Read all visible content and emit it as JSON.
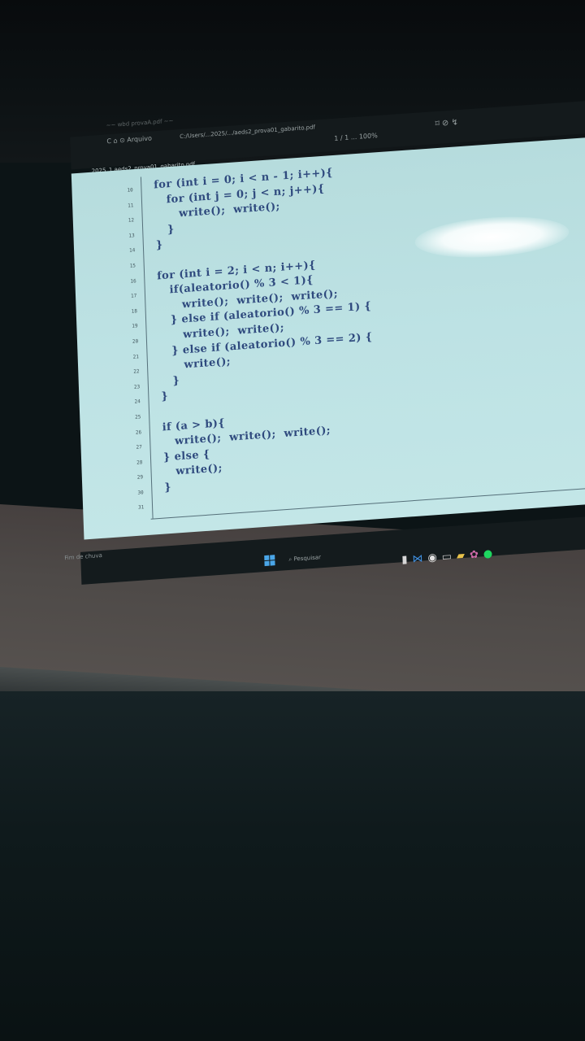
{
  "browser": {
    "tab_text": "~~ wbd provaA.pdf ~~",
    "nav_icons": "C ⌂ ⊙ Arquivo",
    "url": "C:/Users/...2025/.../aeds2_prova01_gabarito.pdf",
    "pdf_title": "2025_1 aeds2_prova01_gabarito.pdf",
    "page_indicator": "1 / 1 ... 100%",
    "right_icons": "⌑ ⊘ ↯"
  },
  "code": {
    "line_numbers": [
      "10",
      "11",
      "12",
      "13",
      "14",
      "15",
      "16",
      "17",
      "18",
      "19",
      "20",
      "21",
      "22",
      "23",
      "24",
      "25",
      "26",
      "27",
      "28",
      "29",
      "30",
      "31"
    ],
    "lines": [
      "for (int i = 0; i < n - 1; i++){",
      "   for (int j = 0; j < n; j++){",
      "      write();  write();",
      "   }",
      "}",
      "",
      "for (int i = 2; i < n; i++){",
      "   if(aleatorio() % 3 < 1){",
      "      write();  write();  write();",
      "   } else if (aleatorio() % 3 == 1) {",
      "      write();  write();",
      "   } else if (aleatorio() % 3 == 2) {",
      "      write();",
      "   }",
      "}",
      "",
      "if (a > b){",
      "   write();  write();  write();",
      "} else {",
      "   write();",
      "}"
    ]
  },
  "taskbar": {
    "weather": "Fim de chuva",
    "search_placeholder": "Pesquisar",
    "icons": [
      "file-explorer-icon",
      "vscode-icon",
      "chrome-icon",
      "terminal-icon",
      "folder-icon",
      "app-icon",
      "spotify-icon"
    ]
  },
  "colors": {
    "slide_bg": "#bde2e4",
    "code_text": "#2f4a7e",
    "taskbar": "#141b1d"
  }
}
